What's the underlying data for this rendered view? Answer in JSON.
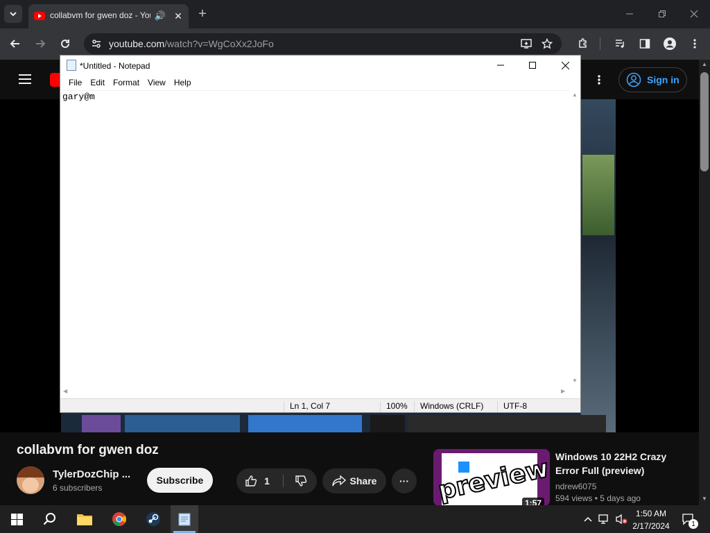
{
  "browser": {
    "tab_title": "collabvm for gwen doz - YouTube",
    "new_tab": "+",
    "url_host": "youtube.com",
    "url_path": "/watch?v=WgCoXx2JoFo"
  },
  "youtube": {
    "sign_in": "Sign in",
    "video_title": "collabvm for gwen doz",
    "channel_name": "TylerDozChip ...",
    "subscribers": "6 subscribers",
    "subscribe": "Subscribe",
    "likes": "1",
    "share": "Share",
    "more": "···",
    "rec": {
      "title": "Windows 10 22H2 Crazy Error Full (preview)",
      "channel": "ndrew6075",
      "views": "594 views",
      "age": "5 days ago",
      "duration": "1:57",
      "overlay": "preview"
    }
  },
  "notepad": {
    "title": "*Untitled - Notepad",
    "menu": [
      "File",
      "Edit",
      "Format",
      "View",
      "Help"
    ],
    "content": "gary@m",
    "status": {
      "position": "Ln 1, Col 7",
      "zoom": "100%",
      "eol": "Windows (CRLF)",
      "encoding": "UTF-8"
    }
  },
  "taskbar": {
    "time": "1:50 AM",
    "date": "2/17/2024",
    "notif_count": "1"
  },
  "colors": {
    "accent": "#3ea6ff",
    "yt_red": "#ff0000"
  }
}
